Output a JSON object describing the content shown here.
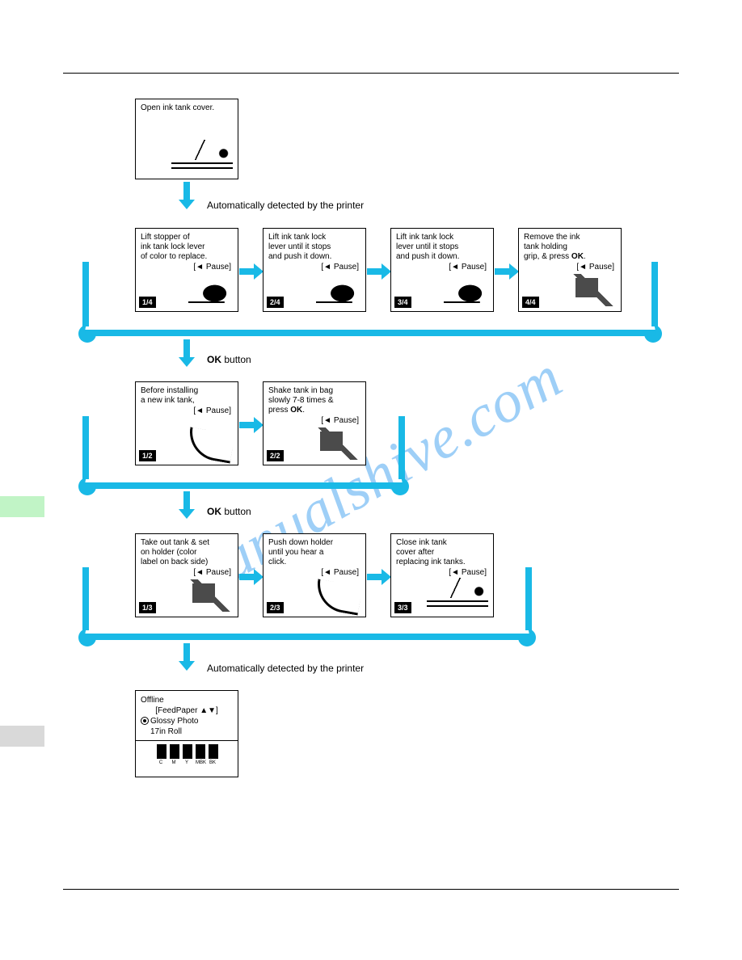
{
  "watermark": "manualshive.com",
  "labels": {
    "auto_detect": "Automatically detected by the printer",
    "ok_button": "button",
    "ok_button_prefix": "OK"
  },
  "pause_label": "[◄  Pause]",
  "rows": {
    "top_single": {
      "text": "Open ink tank cover."
    },
    "r1": [
      {
        "badge": "1/4",
        "text": "Lift stopper of\nink tank lock lever\nof color to replace."
      },
      {
        "badge": "2/4",
        "text": "Lift ink tank lock\nlever until it stops\nand push it down."
      },
      {
        "badge": "3/4",
        "text": "Lift ink tank lock\nlever until it stops\nand push it down."
      },
      {
        "badge": "4/4",
        "text": "Remove the ink\ntank holding\ngrip, & press OK."
      }
    ],
    "r2": [
      {
        "badge": "1/2",
        "text": "Before installing\na new ink tank,"
      },
      {
        "badge": "2/2",
        "text": "Shake tank in bag\nslowly 7-8 times &\npress OK."
      }
    ],
    "r3": [
      {
        "badge": "1/3",
        "text": "Take out tank & set\non holder (color\nlabel on back side)"
      },
      {
        "badge": "2/3",
        "text": "Push down holder\nuntil you hear a\nclick."
      },
      {
        "badge": "3/3",
        "text": "Close ink tank\ncover after\nreplacing ink tanks."
      }
    ]
  },
  "offline": {
    "title": "Offline",
    "feed": "[FeedPaper ▲▼]",
    "media": "Glossy Photo",
    "size": "17in Roll",
    "inks": [
      "C",
      "M",
      "Y",
      "MBK",
      "BK"
    ]
  }
}
